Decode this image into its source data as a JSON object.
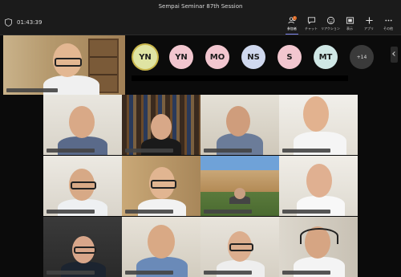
{
  "window": {
    "title": "Sempai Seminar 87th Session"
  },
  "meeting": {
    "elapsed": "01:43:39"
  },
  "toolbar": {
    "items": [
      {
        "name": "participants",
        "label": "参加者",
        "badge": "!",
        "active": true
      },
      {
        "name": "chat",
        "label": "チャット"
      },
      {
        "name": "reactions",
        "label": "リアクション"
      },
      {
        "name": "view",
        "label": "表示"
      },
      {
        "name": "apps",
        "label": "アプリ"
      },
      {
        "name": "more",
        "label": "その他"
      }
    ]
  },
  "roster": {
    "avatars": [
      {
        "initials": "YN"
      },
      {
        "initials": "YN"
      },
      {
        "initials": "MO"
      },
      {
        "initials": "NS"
      },
      {
        "initials": "S"
      },
      {
        "initials": "MT"
      }
    ],
    "overflow": "+14"
  },
  "colors": {
    "accent": "#7b83eb",
    "badge": "#e06a24",
    "background": "#0b0b0b"
  }
}
